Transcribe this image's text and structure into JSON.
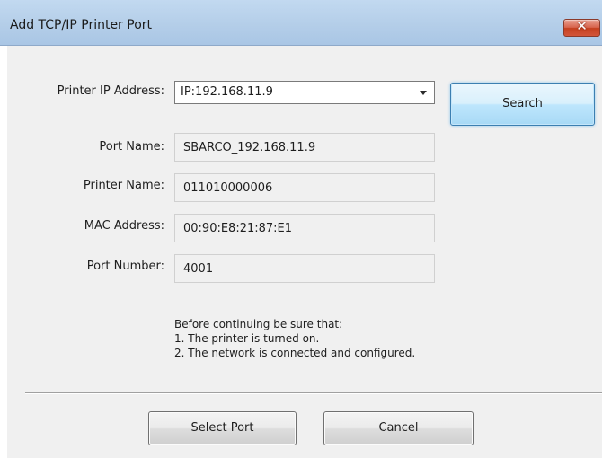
{
  "window": {
    "title": "Add TCP/IP Printer Port",
    "close_glyph": "✕",
    "close_icon": "close-icon"
  },
  "form": {
    "ip_label": "Printer IP Address:",
    "ip_value": "IP:192.168.11.9",
    "port_name_label": "Port Name:",
    "port_name_value": "SBARCO_192.168.11.9",
    "printer_name_label": "Printer Name:",
    "printer_name_value": "011010000006",
    "mac_label": "MAC Address:",
    "mac_value": "00:90:E8:21:87:E1",
    "port_number_label": "Port Number:",
    "port_number_value": "4001"
  },
  "buttons": {
    "search": "Search",
    "select_port": "Select Port",
    "cancel": "Cancel"
  },
  "info": {
    "line1": "Before continuing be sure that:",
    "line2": "1. The printer is turned on.",
    "line3": "2. The network is connected and configured."
  },
  "colors": {
    "titlebar": "#b3cde8",
    "close_button": "#c5401f",
    "search_button_border": "#3c7fb1"
  }
}
